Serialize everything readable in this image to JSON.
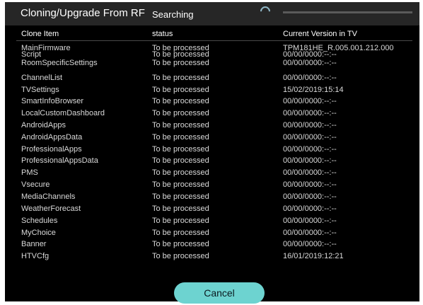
{
  "header": {
    "title": "Cloning/Upgrade From RF",
    "status": "Searching",
    "progress": 0.0
  },
  "columns": [
    "Clone Item",
    "status",
    "Current Version in TV"
  ],
  "rows": [
    {
      "item": "MainFirmware",
      "status": "To be processed",
      "version": "TPM181HE_R.005.001.212.000"
    },
    {
      "item": "Script",
      "status": "To be processed",
      "version": "00/00/0000:--:--"
    },
    {
      "item": "RoomSpecificSettings",
      "status": "To be processed",
      "version": "00/00/0000:--:--"
    },
    {
      "item": "ChannelList",
      "status": "To be processed",
      "version": "00/00/0000:--:--"
    },
    {
      "item": "TVSettings",
      "status": "To be processed",
      "version": "15/02/2019:15:14"
    },
    {
      "item": "SmartInfoBrowser",
      "status": "To be processed",
      "version": "00/00/0000:--:--"
    },
    {
      "item": "LocalCustomDashboard",
      "status": "To be processed",
      "version": "00/00/0000:--:--"
    },
    {
      "item": "AndroidApps",
      "status": "To be processed",
      "version": "00/00/0000:--:--"
    },
    {
      "item": "AndroidAppsData",
      "status": "To be processed",
      "version": "00/00/0000:--:--"
    },
    {
      "item": "ProfessionalApps",
      "status": "To be processed",
      "version": "00/00/0000:--:--"
    },
    {
      "item": "ProfessionalAppsData",
      "status": "To be processed",
      "version": "00/00/0000:--:--"
    },
    {
      "item": "PMS",
      "status": "To be processed",
      "version": "00/00/0000:--:--"
    },
    {
      "item": "Vsecure",
      "status": "To be processed",
      "version": "00/00/0000:--:--"
    },
    {
      "item": "MediaChannels",
      "status": "To be processed",
      "version": "00/00/0000:--:--"
    },
    {
      "item": "WeatherForecast",
      "status": "To be processed",
      "version": "00/00/0000:--:--"
    },
    {
      "item": "Schedules",
      "status": "To be processed",
      "version": "00/00/0000:--:--"
    },
    {
      "item": "MyChoice",
      "status": "To be processed",
      "version": "00/00/0000:--:--"
    },
    {
      "item": "Banner",
      "status": "To be processed",
      "version": "00/00/0000:--:--"
    },
    {
      "item": "HTVCfg",
      "status": "To be processed",
      "version": "16/01/2019:12:21"
    }
  ],
  "footer": {
    "cancel_label": "Cancel"
  },
  "colors": {
    "background": "#000000",
    "header": "#262626",
    "accent": "#6dd3d0",
    "spinner": "#8fb7c7"
  },
  "icons": {
    "spinner": "loading-spinner-icon"
  }
}
